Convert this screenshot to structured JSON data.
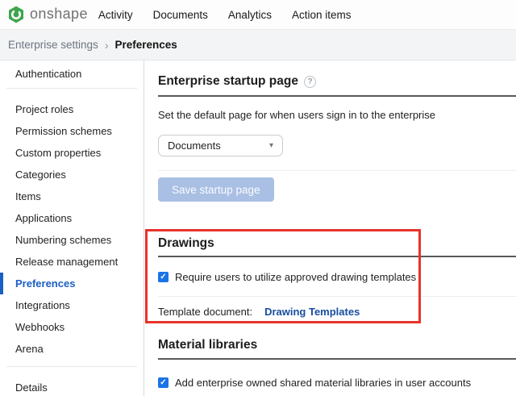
{
  "topbar": {
    "brand": "onshape",
    "nav": [
      {
        "label": "Activity"
      },
      {
        "label": "Documents"
      },
      {
        "label": "Analytics"
      },
      {
        "label": "Action items"
      }
    ]
  },
  "breadcrumb": {
    "parent": "Enterprise settings",
    "separator": "›",
    "current": "Preferences"
  },
  "sidebar": {
    "active_item": "Preferences",
    "items": [
      "Authentication",
      "Project roles",
      "Permission schemes",
      "Custom properties",
      "Categories",
      "Items",
      "Applications",
      "Numbering schemes",
      "Release management",
      "Preferences",
      "Integrations",
      "Webhooks",
      "Arena",
      "Details"
    ]
  },
  "main": {
    "startup": {
      "title": "Enterprise startup page",
      "description": "Set the default page for when users sign in to the enterprise",
      "dropdown_value": "Documents",
      "save_button": "Save startup page",
      "save_button_enabled": false
    },
    "drawings": {
      "title": "Drawings",
      "checkbox_label": "Require users to utilize approved drawing templates",
      "checkbox_checked": true,
      "template_label": "Template document:",
      "template_link": "Drawing Templates"
    },
    "materials": {
      "title": "Material libraries",
      "checkbox_label": "Add enterprise owned shared material libraries in user accounts",
      "checkbox_checked": true
    }
  },
  "icons": {
    "help": "?",
    "dropdown_caret": "▾",
    "checkmark": "✓"
  },
  "colors": {
    "brand_green": "#3ca64c",
    "active_blue": "#1a5fc4",
    "link_blue": "#174ea0",
    "checkbox_blue": "#1a73e8",
    "disabled_button": "#a9bfe4",
    "annotation_red": "#e8332a",
    "breadcrumb_bg": "#f3f4f5"
  }
}
